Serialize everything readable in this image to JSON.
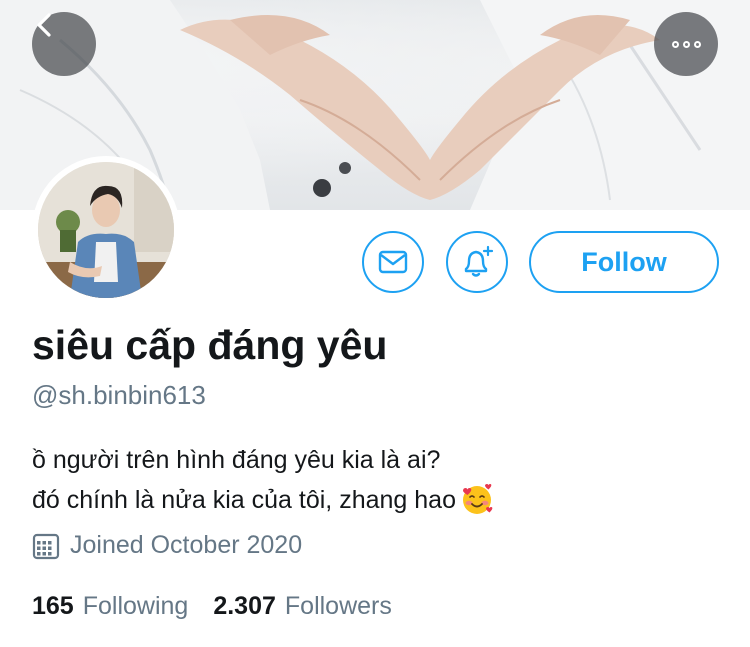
{
  "header": {
    "back_icon": "chevron-left-icon",
    "more_icon": "more-horizontal-icon",
    "banner_image": "two hands forming a heart shape"
  },
  "actions": {
    "message_icon": "mail-icon",
    "notify_icon": "bell-plus-icon",
    "follow_label": "Follow"
  },
  "profile": {
    "display_name": "siêu cấp đáng yêu",
    "handle": "@sh.binbin613",
    "bio_line1": "ồ người trên hình đáng yêu kia là ai?",
    "bio_line2": "đó chính là nửa kia của tôi, zhang hao",
    "bio_emoji": "smiling-face-with-hearts",
    "joined_icon": "calendar-icon",
    "joined": "Joined October 2020"
  },
  "stats": {
    "following_count": "165",
    "following_label": "Following",
    "followers_count": "2.307",
    "followers_label": "Followers"
  },
  "colors": {
    "accent": "#1da1f2",
    "secondary_text": "#657786",
    "primary_text": "#14171a"
  }
}
